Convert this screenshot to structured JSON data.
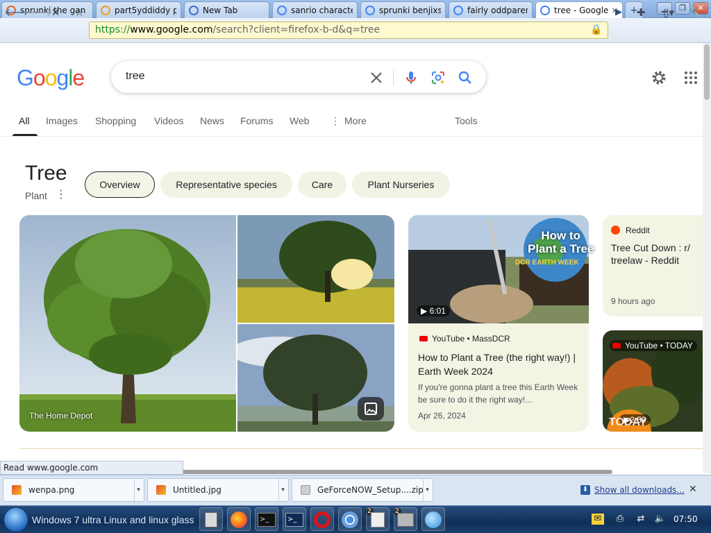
{
  "browser": {
    "tabs": [
      {
        "label": "sprunki the gan",
        "favicon": "chrome-icon",
        "color": "#e06b2c"
      },
      {
        "label": "part5yddiddy par",
        "favicon": "bitcoin-icon",
        "color": "#f0a21b"
      },
      {
        "label": "New Tab",
        "favicon": "new-tab-icon",
        "color": "#3b6fd2"
      },
      {
        "label": "sanrio characte",
        "favicon": "google-icon",
        "color": "#4285f4"
      },
      {
        "label": "sprunki benjixse",
        "favicon": "google-icon",
        "color": "#4285f4"
      },
      {
        "label": "fairly oddparent",
        "favicon": "google-icon",
        "color": "#4285f4"
      },
      {
        "label": "tree - Google",
        "favicon": "loading-icon",
        "color": "#4285f4"
      }
    ],
    "url": {
      "scheme": "https://",
      "host": "www.google.com",
      "path": "/search?client=firefox-b-d&q=tree"
    }
  },
  "google": {
    "logo_letters": [
      {
        "ch": "G",
        "color": "#4285f4"
      },
      {
        "ch": "o",
        "color": "#ea4335"
      },
      {
        "ch": "o",
        "color": "#fbbc05"
      },
      {
        "ch": "g",
        "color": "#4285f4"
      },
      {
        "ch": "l",
        "color": "#34a853"
      },
      {
        "ch": "e",
        "color": "#ea4335"
      }
    ],
    "query": "tree",
    "nav": [
      "All",
      "Images",
      "Shopping",
      "Videos",
      "News",
      "Forums",
      "Web",
      "More",
      "Tools"
    ]
  },
  "knowledge": {
    "title": "Tree",
    "subtitle": "Plant",
    "chips": [
      "Overview",
      "Representative species",
      "Care",
      "Plant Nurseries"
    ],
    "main_image_caption": "The Home Depot"
  },
  "results": {
    "video1": {
      "duration": "6:01",
      "source": "YouTube • MassDCR",
      "title": "How to Plant a Tree (the right way!) | Earth Week 2024",
      "snippet": "If you're gonna plant a tree this Earth Week be sure to do it the right way!...",
      "date": "Apr 26, 2024",
      "thumb_text_1": "How to",
      "thumb_text_2": "Plant a Tree",
      "thumb_text_3": "DCR EARTH WEEK"
    },
    "reddit": {
      "source": "Reddit",
      "title": "Tree Cut Down : r/ treelaw - Reddit",
      "date": "9 hours ago"
    },
    "video2": {
      "source": "YouTube • TODAY",
      "duration": "2:59",
      "logo": "TODAY"
    }
  },
  "status": "Read www.google.com",
  "downloads": {
    "items": [
      "wenpa.png",
      "Untitled.jpg",
      "GeForceNOW_Setup....zip"
    ],
    "show_all": "Show all downloads..."
  },
  "taskbar": {
    "start_label": "Windows 7 ultra Linux and linux glass",
    "badges": [
      "2",
      "2"
    ],
    "clock": "07:50"
  }
}
